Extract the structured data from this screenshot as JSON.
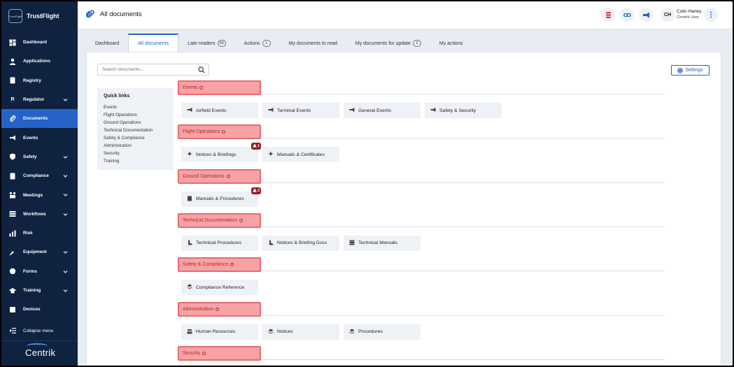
{
  "brand": {
    "logo_text": "TrustFlight",
    "name": "TrustFlight"
  },
  "sidebar": {
    "items": [
      {
        "label": "Dashboard",
        "icon": "dashboard-icon",
        "expandable": false,
        "active": false
      },
      {
        "label": "Applications",
        "icon": "user-icon",
        "expandable": false,
        "active": false
      },
      {
        "label": "Registry",
        "icon": "registry-icon",
        "expandable": false,
        "active": false
      },
      {
        "label": "Regulator",
        "icon": "regulator-icon",
        "icon_glyph": "R",
        "expandable": true,
        "active": false
      },
      {
        "label": "Documents",
        "icon": "paperclip-icon",
        "expandable": false,
        "active": true
      },
      {
        "label": "Events",
        "icon": "megaphone-icon",
        "expandable": false,
        "active": false
      },
      {
        "label": "Safety",
        "icon": "shield-icon",
        "expandable": true,
        "active": false
      },
      {
        "label": "Compliance",
        "icon": "compliance-icon",
        "expandable": true,
        "active": false
      },
      {
        "label": "Meetings",
        "icon": "meetings-icon",
        "expandable": true,
        "active": false
      },
      {
        "label": "Workflows",
        "icon": "workflow-icon",
        "expandable": true,
        "active": false
      },
      {
        "label": "Risk",
        "icon": "risk-icon",
        "expandable": false,
        "active": false
      },
      {
        "label": "Equipment",
        "icon": "wrench-icon",
        "expandable": true,
        "active": false
      },
      {
        "label": "Forms",
        "icon": "forms-icon",
        "expandable": true,
        "active": false
      },
      {
        "label": "Training",
        "icon": "graduation-cap-icon",
        "expandable": true,
        "active": false
      },
      {
        "label": "Devices",
        "icon": "devices-icon",
        "expandable": false,
        "active": false
      }
    ],
    "collapse_label": "Collapse menu",
    "footer_logo": "Centrik"
  },
  "header": {
    "title": "All documents",
    "user_initials": "CH",
    "user_name": "Colin Harley",
    "user_role": "Centrik User"
  },
  "tabs": [
    {
      "label": "Dashboard",
      "badge": null,
      "active": false
    },
    {
      "label": "All documents",
      "badge": null,
      "active": true
    },
    {
      "label": "Late readers",
      "badge": "59",
      "active": false
    },
    {
      "label": "Actions",
      "badge": "1",
      "active": false
    },
    {
      "label": "My documents to read",
      "badge": null,
      "active": false
    },
    {
      "label": "My documents for update",
      "badge": "2",
      "active": false
    },
    {
      "label": "My actions",
      "badge": null,
      "active": false
    }
  ],
  "search": {
    "placeholder": "Search documents...",
    "value": ""
  },
  "settings_label": "Settings",
  "quick_links": {
    "title": "Quick links",
    "items": [
      "Events",
      "Flight Operations",
      "Ground Operations",
      "Technical Documentation",
      "Safety & Compliance",
      "Administration",
      "Security",
      "Training"
    ]
  },
  "sections": [
    {
      "title": "Events",
      "chips": [
        {
          "label": "Airfield Events",
          "icon": "megaphone-icon",
          "warning": null
        },
        {
          "label": "Terminal Events",
          "icon": "megaphone-icon",
          "warning": null
        },
        {
          "label": "General Events",
          "icon": "megaphone-icon",
          "warning": null
        },
        {
          "label": "Safety & Security",
          "icon": "megaphone-icon",
          "warning": null
        }
      ]
    },
    {
      "title": "Flight Operations",
      "chips": [
        {
          "label": "Notices & Briefings",
          "icon": "sparkle-icon",
          "warning": "1"
        },
        {
          "label": "Manuals & Certificates",
          "icon": "sparkle-icon",
          "warning": null
        }
      ]
    },
    {
      "title": "Ground Operations",
      "chips": [
        {
          "label": "Manuals & Procedures",
          "icon": "building-icon",
          "warning": "2"
        }
      ]
    },
    {
      "title": "Technical Documentation",
      "chips": [
        {
          "label": "Technical Procedures",
          "icon": "boot-icon",
          "warning": null
        },
        {
          "label": "Notices & Briefing Docs",
          "icon": "boot-icon",
          "warning": null
        },
        {
          "label": "Technical Manuals",
          "icon": "server-icon",
          "warning": null
        }
      ]
    },
    {
      "title": "Safety & Compliance",
      "chips": [
        {
          "label": "Compliance Reference",
          "icon": "layers-icon",
          "warning": null
        }
      ]
    },
    {
      "title": "Administration",
      "chips": [
        {
          "label": "Human Resources",
          "icon": "people-icon",
          "warning": null
        },
        {
          "label": "Notices",
          "icon": "layers-icon",
          "warning": null
        },
        {
          "label": "Procedures",
          "icon": "layers-icon",
          "warning": null
        }
      ]
    },
    {
      "title": "Security",
      "chips": []
    }
  ],
  "colors": {
    "sidebar_bg": "#0f2340",
    "accent": "#2563c9",
    "section_highlight": "#f7a3a6",
    "warning": "#9e1c24"
  }
}
